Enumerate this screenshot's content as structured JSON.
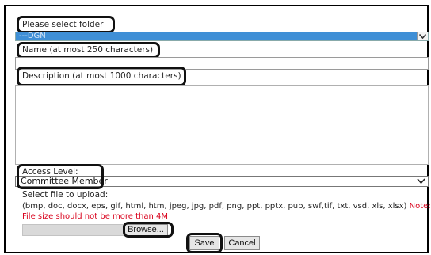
{
  "form": {
    "folder_label": "Please select folder",
    "folder_value": "---DGN",
    "name_label": "Name (at most 250 characters)",
    "name_value": "",
    "description_label": "Description (at most 1000 characters)",
    "description_value": "",
    "access_label": "Access Level:",
    "access_value": "Committee Member",
    "upload_label": "Select file to upload:",
    "file_types": "(bmp, doc, docx, eps, gif, html, htm, jpeg, jpg, pdf, png, ppt, pptx, pub, swf,tif, txt, vsd, xls, xlsx)",
    "note_label": "Note:",
    "size_warning": "File size should not be more than 4M",
    "browse_label": "Browse...",
    "save_label": "Save",
    "cancel_label": "Cancel"
  },
  "colors": {
    "highlight_border": "#111111",
    "selected_folder_bg": "#3f8fd6",
    "warning_text": "#d9001b"
  }
}
